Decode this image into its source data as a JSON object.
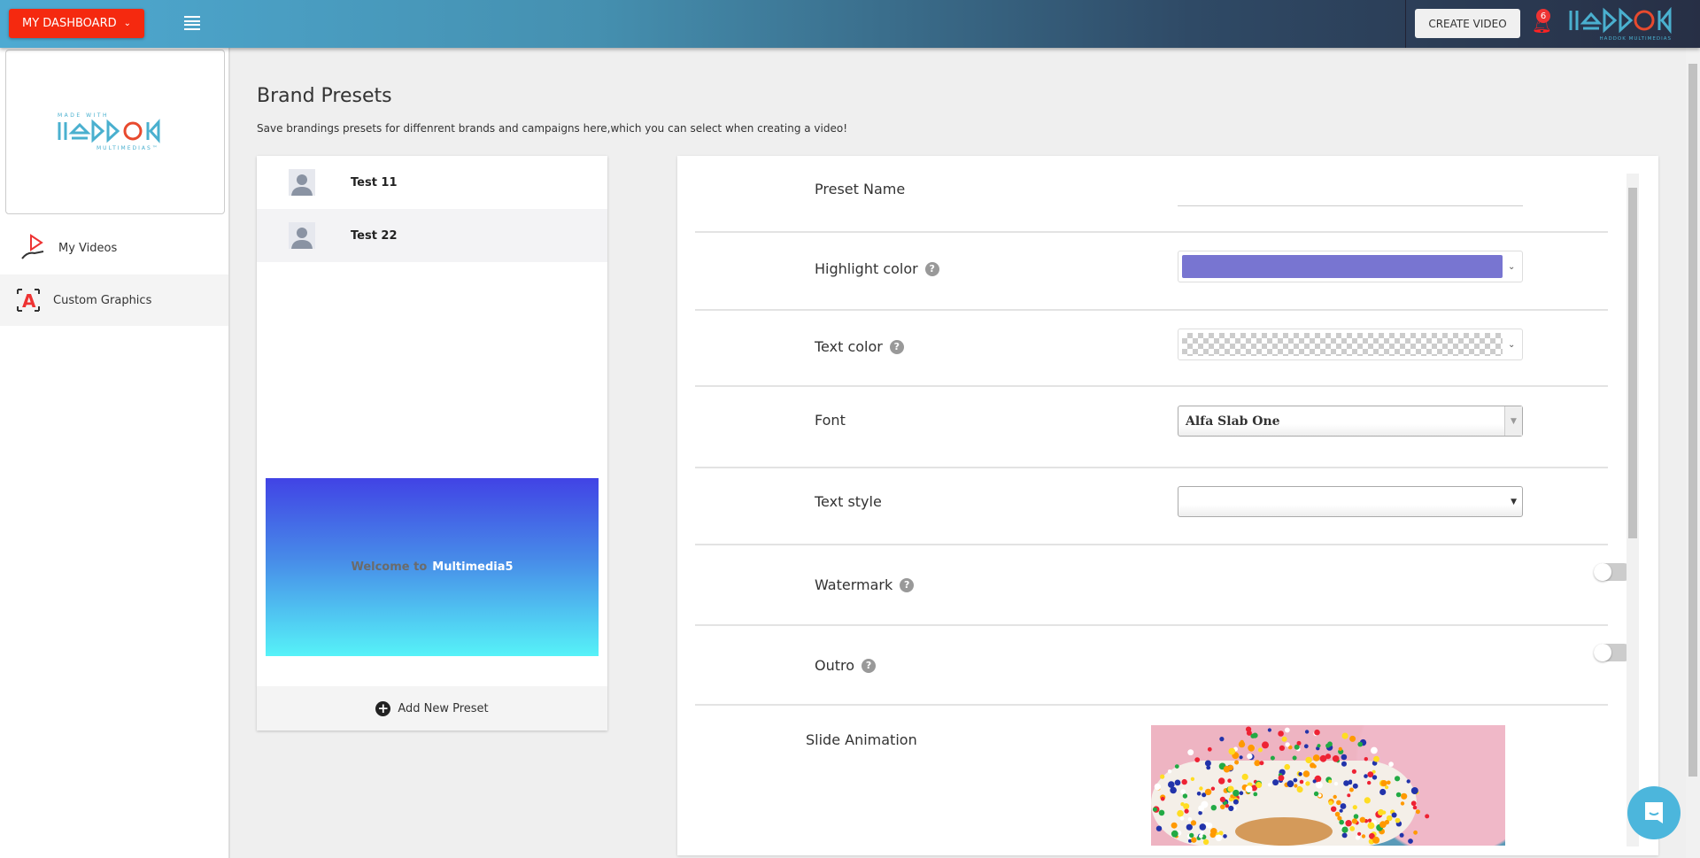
{
  "header": {
    "dashboard_label": "MY DASHBOARD",
    "create_video_label": "CREATE VIDEO",
    "notification_count": "6",
    "brand_logo_text": "HADDOK MULTIMEDIAS"
  },
  "sidebar": {
    "logo_text": "MADE WITH HADDOK MULTIMEDIAS",
    "items": [
      {
        "label": "My Videos"
      },
      {
        "label": "Custom Graphics"
      }
    ]
  },
  "page": {
    "title": "Brand Presets",
    "subtitle": "Save brandings presets for diffenrent brands and campaigns here,which you can select when creating a video!"
  },
  "presets": {
    "items": [
      {
        "name": "Test 11"
      },
      {
        "name": "Test 22"
      }
    ],
    "preview": {
      "welcome": "Welcome to",
      "brand": "Multimedia5"
    },
    "add_label": "Add New Preset"
  },
  "form": {
    "preset_name": {
      "label": "Preset Name",
      "value": ""
    },
    "highlight": {
      "label": "Highlight color",
      "color": "#7875d1"
    },
    "text_color": {
      "label": "Text color"
    },
    "font": {
      "label": "Font",
      "value": "Alfa Slab One"
    },
    "text_style": {
      "label": "Text style",
      "value": ""
    },
    "watermark": {
      "label": "Watermark",
      "enabled": false
    },
    "outro": {
      "label": "Outro",
      "enabled": false
    },
    "slide_animation": {
      "label": "Slide Animation"
    },
    "help_glyph": "?"
  },
  "colors": {
    "accent": "#f5290f",
    "header_start": "#4eaad2",
    "header_end": "#272f45"
  }
}
